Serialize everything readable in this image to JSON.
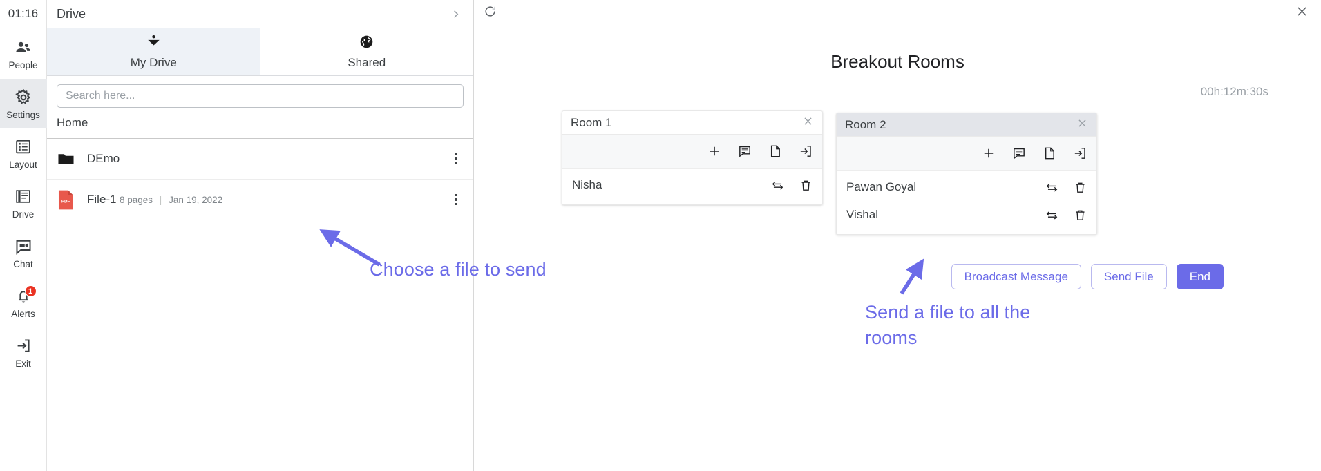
{
  "rail": {
    "clock": "01:16",
    "items": [
      {
        "label": "People",
        "icon": "people-icon",
        "active": false,
        "badge": null
      },
      {
        "label": "Settings",
        "icon": "gear-icon",
        "active": true,
        "badge": null
      },
      {
        "label": "Layout",
        "icon": "layout-icon",
        "active": false,
        "badge": null
      },
      {
        "label": "Drive",
        "icon": "drive-icon",
        "active": false,
        "badge": null
      },
      {
        "label": "Chat",
        "icon": "chat-icon",
        "active": false,
        "badge": null
      },
      {
        "label": "Alerts",
        "icon": "bell-icon",
        "active": false,
        "badge": "1"
      },
      {
        "label": "Exit",
        "icon": "exit-icon",
        "active": false,
        "badge": null
      }
    ]
  },
  "drive": {
    "title": "Drive",
    "collapse_icon": "chevron-right-icon",
    "tabs": [
      {
        "label": "My Drive",
        "icon": "book-icon",
        "active": true
      },
      {
        "label": "Shared",
        "icon": "globe-icon",
        "active": false
      }
    ],
    "search": {
      "value": "",
      "placeholder": "Search here..."
    },
    "breadcrumb": "Home",
    "files": [
      {
        "name": "DEmo",
        "type": "folder",
        "pages": "",
        "date": "",
        "separator": ""
      },
      {
        "name": "File-1",
        "type": "pdf",
        "badge": "PDF",
        "pages": "8 pages",
        "separator": "|",
        "date": "Jan 19, 2022"
      }
    ]
  },
  "main": {
    "refresh_icon": "refresh-icon",
    "close_icon": "close-icon",
    "title": "Breakout Rooms",
    "timer": "00h:12m:30s",
    "room_tools": [
      {
        "icon": "plus-icon",
        "name": "add-participant"
      },
      {
        "icon": "chat-icon",
        "name": "room-chat"
      },
      {
        "icon": "file-icon",
        "name": "send-file-to-room"
      },
      {
        "icon": "enter-icon",
        "name": "join-room"
      }
    ],
    "member_actions": [
      {
        "icon": "swap-icon",
        "name": "move-participant"
      },
      {
        "icon": "trash-icon",
        "name": "remove-participant"
      }
    ],
    "rooms": [
      {
        "name": "Room 1",
        "header_style": "white",
        "close_icon": "close-icon",
        "members": [
          "Nisha"
        ]
      },
      {
        "name": "Room 2",
        "header_style": "grey",
        "close_icon": "close-icon",
        "members": [
          "Pawan Goyal",
          "Vishal"
        ]
      }
    ],
    "buttons": [
      {
        "label": "Broadcast Message",
        "style": "outline"
      },
      {
        "label": "Send File",
        "style": "outline"
      },
      {
        "label": "End",
        "style": "solid"
      }
    ]
  },
  "annotations": [
    {
      "text": "Choose a file to send"
    },
    {
      "text": "Send a file to all the rooms"
    }
  ],
  "colors": {
    "accent": "#6b6be8",
    "badge_red": "#ea3323",
    "pdf_red": "#e8584c",
    "active_rail": "#e8eaed",
    "active_tab": "#eef2f7",
    "room_header_grey": "#e3e5ea",
    "room_toolbar": "#f7f8f9",
    "muted_text": "#9aa0a6"
  }
}
